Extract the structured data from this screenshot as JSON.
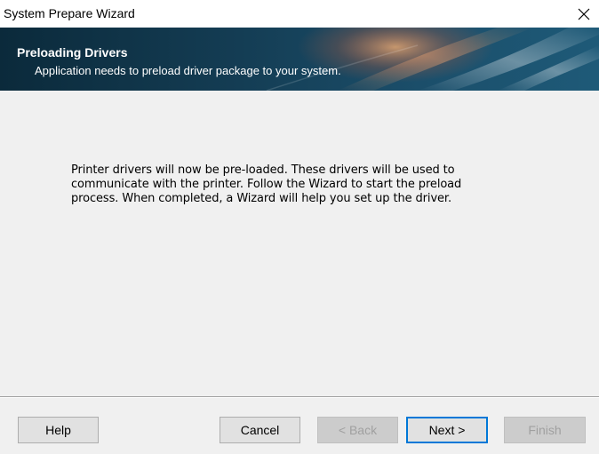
{
  "window": {
    "title": "System Prepare Wizard"
  },
  "banner": {
    "title": "Preloading Drivers",
    "subtitle": "Application needs to preload driver package to your system."
  },
  "content": {
    "message_lines": [
      "Printer drivers will now be pre-loaded. These drivers will be used to",
      "communicate with the printer. Follow the Wizard to start the preload",
      "process. When completed, a Wizard will help you set up the driver."
    ]
  },
  "buttons": {
    "help": "Help",
    "cancel": "Cancel",
    "back": "< Back",
    "next": "Next >",
    "finish": "Finish"
  },
  "colors": {
    "banner_dark": "#0b2a3b",
    "banner_light": "#1e5a78",
    "accent_focus": "#0078d7",
    "dialog_bg": "#f0f0f0"
  },
  "icons": {
    "close": "close-icon"
  }
}
